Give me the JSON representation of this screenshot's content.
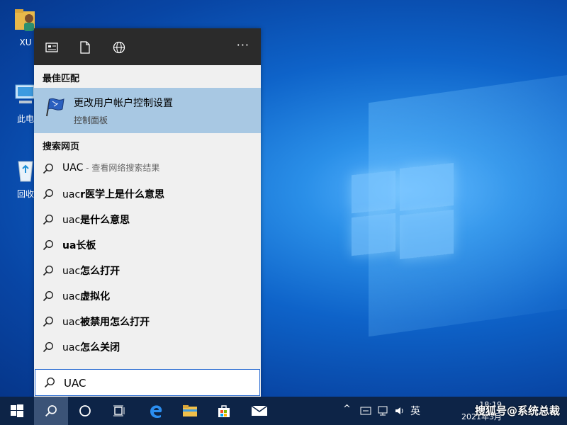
{
  "desktop": {
    "icons": [
      {
        "label": "XU",
        "icon": "user-folder-icon"
      },
      {
        "label": "此电",
        "icon": "computer-icon"
      },
      {
        "label": "回收",
        "icon": "recycle-bin-icon"
      }
    ]
  },
  "panel": {
    "topbar_icons": [
      "apps-icon",
      "document-icon",
      "web-globe-icon"
    ],
    "more_label": "···",
    "best_match_header": "最佳匹配",
    "best_match": {
      "title": "更改用户帐户控制设置",
      "subtitle": "控制面板",
      "icon": "uac-flag-icon"
    },
    "web_header": "搜索网页",
    "web_results": [
      {
        "query": "UAC",
        "hint": " - 查看网络搜索结果"
      },
      {
        "prefix": "uac",
        "bold": "r医学上是什么意思"
      },
      {
        "prefix": "uac",
        "bold": "是什么意思"
      },
      {
        "prefix": "ua",
        "bold": "长板"
      },
      {
        "prefix": "uac",
        "bold": "怎么打开"
      },
      {
        "prefix": "uac",
        "bold": "虚拟化"
      },
      {
        "prefix": "uac",
        "bold": "被禁用怎么打开"
      },
      {
        "prefix": "uac",
        "bold": "怎么关闭"
      }
    ]
  },
  "search": {
    "value": "UAC"
  },
  "taskbar": {
    "buttons": [
      "windows-start-icon",
      "search-icon",
      "cortana-icon",
      "task-view-icon",
      "edge-icon",
      "file-explorer-icon",
      "store-icon",
      "mail-icon"
    ],
    "tray": {
      "chevron": "^",
      "ime": "英"
    },
    "clock_time": "18:19",
    "clock_date": "2021年3月",
    "watermark": "搜狐号@系统总裁"
  },
  "colors": {
    "accent": "#0078d7",
    "best_match_bg": "#a8c8e3",
    "taskbar": "#0d2447"
  }
}
